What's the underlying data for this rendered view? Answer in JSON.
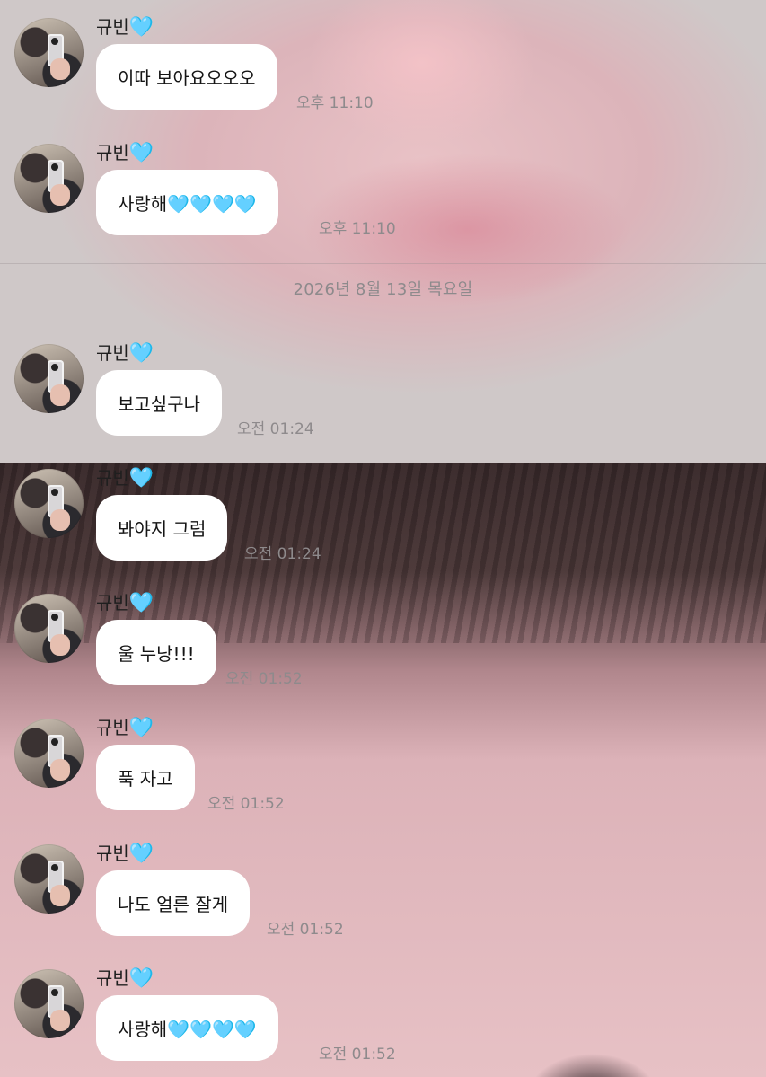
{
  "colors": {
    "bubble": "#ffffff",
    "text": "#151515",
    "time": "#8e8a8c",
    "heart": "#5cc8f2"
  },
  "icons": {
    "heart": "light-blue-heart-icon",
    "avatar": "profile-avatar"
  },
  "chat": {
    "date_divider": "2026년 8월 13일 목요일",
    "messages": [
      {
        "sender": "규빈",
        "sender_heart": "🩵",
        "text": "이따 보아요오오오",
        "time": "오후 11:10"
      },
      {
        "sender": "규빈",
        "sender_heart": "🩵",
        "text": "사랑해🩵🩵🩵🩵",
        "time": "오후 11:10"
      },
      {
        "sender": "규빈",
        "sender_heart": "🩵",
        "text": "보고싶구나",
        "time": "오전 01:24"
      },
      {
        "sender": "규빈",
        "sender_heart": "🩵",
        "text": "봐야지 그럼",
        "time": "오전 01:24"
      },
      {
        "sender": "규빈",
        "sender_heart": "🩵",
        "text": "울 누낭!!!",
        "time": "오전 01:52"
      },
      {
        "sender": "규빈",
        "sender_heart": "🩵",
        "text": "푹 자고",
        "time": "오전 01:52"
      },
      {
        "sender": "규빈",
        "sender_heart": "🩵",
        "text": "나도 얼른 잘게",
        "time": "오전 01:52"
      },
      {
        "sender": "규빈",
        "sender_heart": "🩵",
        "text": "사랑해🩵🩵🩵🩵",
        "time": "오전 01:52"
      }
    ]
  }
}
